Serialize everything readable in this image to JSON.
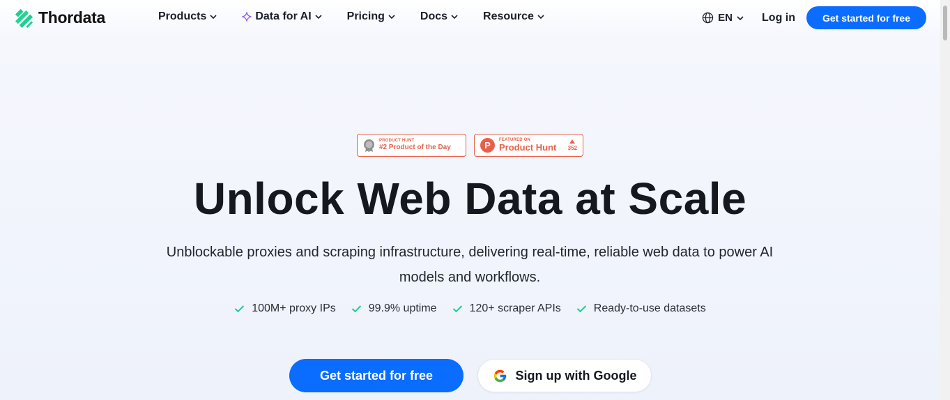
{
  "brand": {
    "name": "Thordata",
    "color": "#1ecf8f"
  },
  "nav": {
    "items": [
      {
        "label": "Products",
        "icon": "chevron-down-icon"
      },
      {
        "label": "Data for AI",
        "icon": "chevron-down-icon",
        "prefix_icon": "sparkle-icon"
      },
      {
        "label": "Pricing",
        "icon": "chevron-down-icon"
      },
      {
        "label": "Docs",
        "icon": "chevron-down-icon"
      },
      {
        "label": "Resource",
        "icon": "chevron-down-icon"
      }
    ],
    "language": "EN",
    "login": "Log in",
    "cta": "Get started for free"
  },
  "badges": [
    {
      "small": "PRODUCT HUNT",
      "big": "#2 Product of the Day",
      "icon": "medal-icon"
    },
    {
      "small": "FEATURED ON",
      "big": "Product Hunt",
      "votes": "352",
      "icon": "product-hunt-icon"
    }
  ],
  "hero": {
    "title": "Unlock Web Data at Scale",
    "subtitle": "Unblockable proxies and scraping infrastructure, delivering real-time, reliable web data to power AI models and workflows.",
    "features": [
      "100M+ proxy IPs",
      "99.9% uptime",
      "120+ scraper APIs",
      "Ready-to-use datasets"
    ],
    "primary_cta": "Get started for free",
    "google_cta": "Sign up with Google"
  },
  "colors": {
    "accent": "#0a6dff",
    "check": "#1ecf8f",
    "badge": "#e8604a"
  }
}
